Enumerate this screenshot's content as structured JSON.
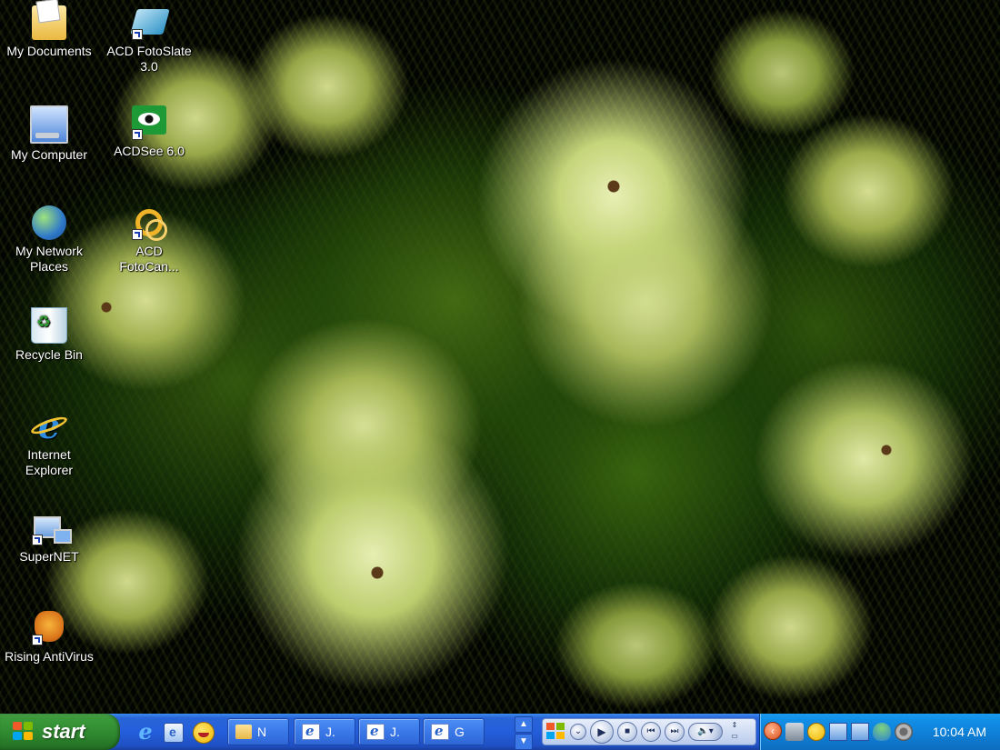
{
  "desktop": {
    "icons": [
      {
        "label": "My Documents",
        "icon": "folder-documents-icon"
      },
      {
        "label": "My Computer",
        "icon": "computer-icon"
      },
      {
        "label": "My Network Places",
        "icon": "network-places-icon"
      },
      {
        "label": "Recycle Bin",
        "icon": "recycle-bin-icon"
      },
      {
        "label": "Internet Explorer",
        "icon": "internet-explorer-icon"
      },
      {
        "label": "SuperNET",
        "icon": "network-computer-icon",
        "shortcut": true
      },
      {
        "label": "Rising AntiVirus",
        "icon": "rising-antivirus-icon",
        "shortcut": true
      },
      {
        "label": "ACD FotoSlate 3.0",
        "icon": "fotoslate-icon",
        "shortcut": true
      },
      {
        "label": "ACDSee 6.0",
        "icon": "acdsee-icon",
        "shortcut": true
      },
      {
        "label": "ACD FotoCan...",
        "icon": "fotocanvas-icon",
        "shortcut": true
      }
    ]
  },
  "taskbar": {
    "start_label": "start",
    "quick_launch": [
      "internet-explorer-icon",
      "outlook-express-icon",
      "messenger-icon"
    ],
    "buttons": [
      {
        "label": "N",
        "icon": "folder-icon"
      },
      {
        "label": "J.",
        "icon": "internet-explorer-icon"
      },
      {
        "label": "J.",
        "icon": "internet-explorer-icon"
      },
      {
        "label": "G",
        "icon": "internet-explorer-icon"
      }
    ],
    "media_player": {
      "controls": [
        "windows-logo-icon",
        "chevron-down-icon",
        "play-icon",
        "stop-icon",
        "previous-icon",
        "next-icon",
        "volume-icon",
        "restore-icon"
      ]
    },
    "tray": {
      "icons": [
        "show-hidden-icons-icon",
        "camera-icon",
        "messenger-icon",
        "network-icon",
        "network-icon",
        "user-icon",
        "settings-icon"
      ],
      "clock": "10:04 AM"
    }
  }
}
